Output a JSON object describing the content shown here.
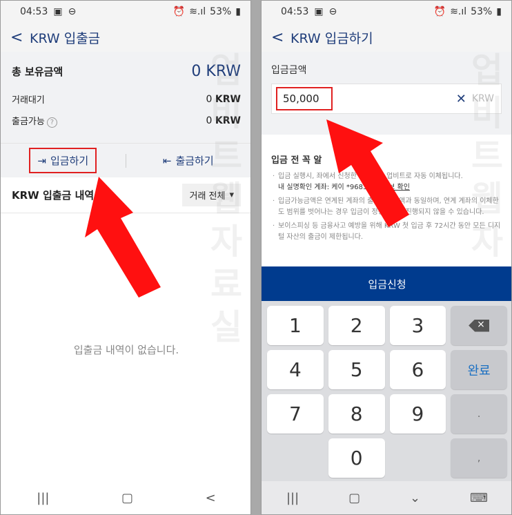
{
  "status_bar": {
    "time": "04:53",
    "battery": "53%",
    "signal_glyph": "⛛",
    "alarm_glyph": "⏰"
  },
  "left": {
    "header": {
      "title": "KRW 입출금"
    },
    "summary": {
      "total_label": "총 보유금액",
      "total_value": "0 KRW",
      "pending_label": "거래대기",
      "pending_number": "0",
      "pending_unit": "KRW",
      "withdrawable_label": "출금가능",
      "withdrawable_number": "0",
      "withdrawable_unit": "KRW"
    },
    "actions": {
      "deposit_label": "입금하기",
      "withdraw_label": "출금하기"
    },
    "history": {
      "title": "KRW 입출금 내역",
      "filter_label": "거래 전체"
    },
    "empty_message": "입출금 내역이 없습니다."
  },
  "right": {
    "header": {
      "title": "KRW 입금하기"
    },
    "deposit": {
      "label": "입금금액",
      "value": "50,000",
      "unit": "KRW"
    },
    "notice": {
      "title": "입금 전 꼭 알",
      "items": [
        {
          "text": "입금 실행시,       좌에서 신청한 금액만큼 업비트로 자동 이체됩니다.",
          "strong": "내 실명확인 계좌: 케이      *9683",
          "link": "계좌정보 확인"
        },
        {
          "text": "입금가능금액은 연계된         계좌의 출금가능금액과 동일하며, 연계 계좌의 이체한도 범위를 벗어나는 경우 입금이 정상적으로 진행되지 않을 수 있습니다."
        },
        {
          "text": "보이스피싱 등 금융사고 예방을 위해 KRW 첫 입금 후 72시간 동안 모든 디지털 자산의 출금이 제한됩니다."
        }
      ]
    },
    "submit_label": "입금신청",
    "keypad": {
      "keys": [
        "1",
        "2",
        "3",
        "4",
        "5",
        "6",
        "7",
        "8",
        "9",
        "0"
      ],
      "done_label": "완료",
      "dot_label": ".",
      "comma_label": ","
    }
  },
  "watermark": "업비트 웹 자료실",
  "colors": {
    "brand": "#1f3d7a",
    "submit": "#003b8e",
    "highlight": "#e02020"
  }
}
